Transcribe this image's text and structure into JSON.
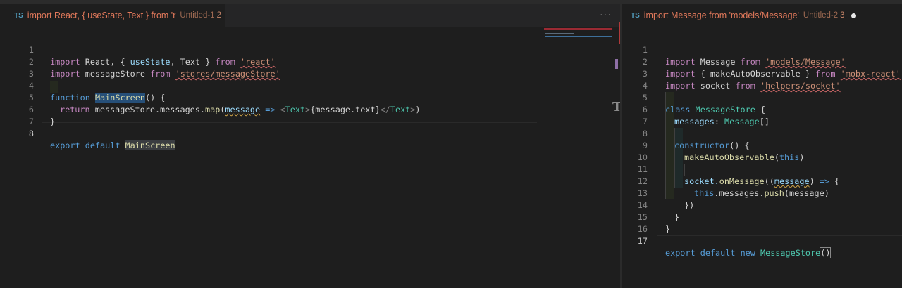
{
  "left_editor": {
    "tab": {
      "lang_icon": "TS",
      "title": "import React, { useState, Text } from 'r",
      "description": "Untitled-1",
      "problem_count": "2"
    },
    "more_actions": "···",
    "line_numbers": [
      "1",
      "2",
      "3",
      "4",
      "5",
      "6",
      "7",
      "8"
    ],
    "active_line": "8",
    "lines": [
      [
        "import",
        " React, { ",
        "useState",
        ", Text } ",
        "from",
        " ",
        "'react'"
      ],
      [
        "import",
        " messageStore ",
        "from",
        " ",
        "'stores/messageStore'"
      ],
      [],
      [
        "function",
        " ",
        "MainScreen",
        "() {"
      ],
      [
        "return",
        " messageStore.messages.",
        "map",
        "(",
        "message",
        " ",
        "=>",
        " ",
        "<",
        "Text",
        ">",
        "{message.text}",
        "</",
        "Text",
        ">",
        ")"
      ],
      [
        "}"
      ],
      [],
      [
        "export",
        " ",
        "default",
        " ",
        "MainScreen"
      ]
    ]
  },
  "right_editor": {
    "tab": {
      "lang_icon": "TS",
      "title": "import Message from 'models/Message'",
      "description": "Untitled-2",
      "problem_count": "3"
    },
    "line_numbers": [
      "1",
      "2",
      "3",
      "4",
      "5",
      "6",
      "7",
      "8",
      "9",
      "10",
      "11",
      "12",
      "13",
      "14",
      "15",
      "16",
      "17"
    ],
    "active_line": "17",
    "lines": [
      [
        "import",
        " Message ",
        "from",
        " ",
        "'models/Message'"
      ],
      [
        "import",
        " { makeAutoObservable } ",
        "from",
        " ",
        "'mobx-react'"
      ],
      [
        "import",
        " socket ",
        "from",
        " ",
        "'helpers/socket'"
      ],
      [],
      [
        "class",
        " ",
        "MessageStore",
        " {"
      ],
      [
        "messages",
        ": ",
        "Message",
        "[]"
      ],
      [],
      [
        "constructor",
        "() {"
      ],
      [
        "makeAutoObservable",
        "(",
        "this",
        ")"
      ],
      [],
      [
        "socket.",
        "onMessage",
        "((",
        "message",
        ") ",
        "=>",
        " {"
      ],
      [
        "this",
        ".messages.",
        "push",
        "(message)"
      ],
      [
        "})"
      ],
      [
        "}"
      ],
      [
        "}"
      ],
      [],
      [
        "export",
        " ",
        "default",
        " ",
        "new",
        " ",
        "MessageStore",
        "()"
      ]
    ]
  },
  "colors": {
    "background": "#1e1e1e",
    "keyword": "#569cd6",
    "control": "#c586c0",
    "function": "#dcdcaa",
    "type": "#4ec9b0",
    "string": "#ce9178",
    "tab_title": "#e2795b"
  },
  "icons": {
    "tab_language": "typescript-icon",
    "dirty": "dirty-dot-icon",
    "more": "ellipsis-icon"
  }
}
